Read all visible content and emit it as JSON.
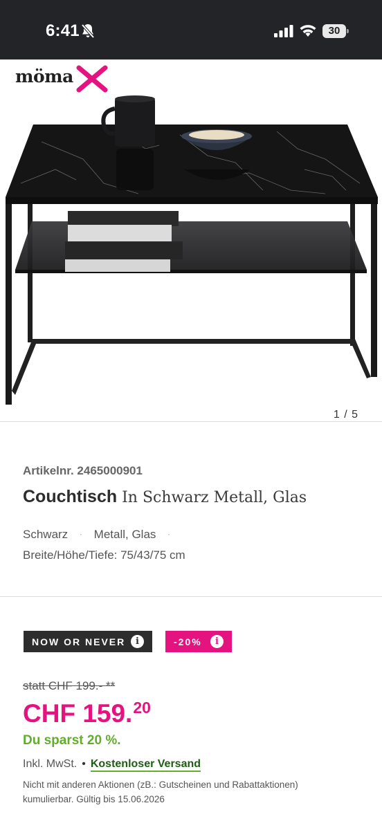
{
  "status_bar": {
    "time": "6:41",
    "battery": "30",
    "icons": [
      "bell-slash-icon",
      "signal-icon",
      "wifi-icon",
      "battery-icon"
    ]
  },
  "brand": {
    "logo_text": "möma",
    "logo_accent_color": "#e5137f"
  },
  "gallery": {
    "counter": "1 / 5"
  },
  "product": {
    "article_no": "Artikelnr. 2465000901",
    "title_bold": "Couchtisch",
    "title_rest": " In Schwarz Metall, Glas",
    "attributes": [
      "Schwarz",
      "Metall, Glas"
    ],
    "dimensions": "Breite/Höhe/Tiefe: 75/43/75 cm"
  },
  "promo": {
    "badge_now": "NOW OR NEVER",
    "badge_discount": "-20%",
    "info_glyph": "i"
  },
  "pricing": {
    "old_price": "statt CHF 199.- **",
    "price_main": "CHF 159.",
    "price_cents": "20",
    "savings": "Du sparst 20 %.",
    "tax_note": "Inkl. MwSt.",
    "shipping": "Kostenloser Versand",
    "disclaimer": "Nicht mit anderen Aktionen (zB.: Gutscheinen und Rabattaktionen) kumulierbar. Gültig bis 15.06.2026"
  },
  "colors": {
    "accent_pink": "#e5137f",
    "savings_green": "#62ad2c",
    "dark_badge": "#2d2d2d",
    "status_bar": "#222427"
  }
}
